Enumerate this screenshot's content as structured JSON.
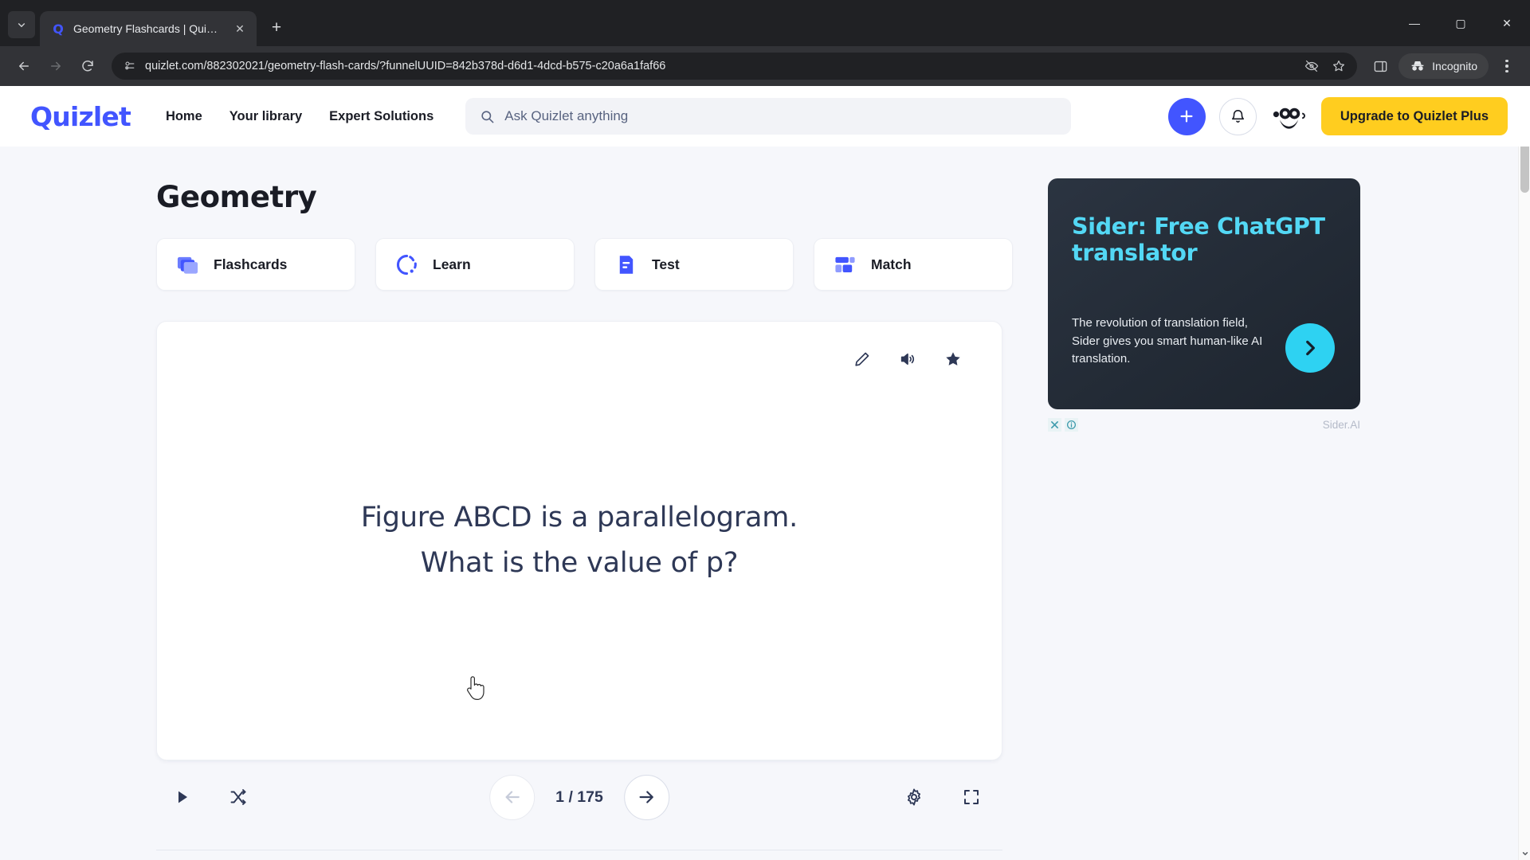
{
  "browser": {
    "tab": {
      "title": "Geometry Flashcards | Quizlet",
      "favicon_icon": "quizlet-q-favicon",
      "close_icon": "close-icon"
    },
    "tab_list_icon": "chevron-down-icon",
    "new_tab_icon": "plus-icon",
    "window_controls": {
      "minimize": "minimize-icon",
      "maximize": "maximize-icon",
      "close": "close-icon"
    },
    "nav": {
      "back_icon": "back-arrow-icon",
      "forward_icon": "forward-arrow-icon",
      "reload_icon": "reload-icon"
    },
    "omnibox": {
      "site_info_icon": "site-settings-icon",
      "url": "quizlet.com/882302021/geometry-flash-cards/?funnelUUID=842b378d-d6d1-4dcd-b575-c20a6a1faf66",
      "tracking_icon": "eye-slash-icon",
      "bookmark_icon": "star-outline-icon"
    },
    "side_panel_icon": "side-panel-icon",
    "incognito": {
      "label": "Incognito",
      "icon": "incognito-icon"
    },
    "menu_icon": "three-dot-menu-icon"
  },
  "quizlet_header": {
    "logo": "Quizlet",
    "nav": [
      {
        "label": "Home",
        "name": "nav-home"
      },
      {
        "label": "Your library",
        "name": "nav-your-library"
      },
      {
        "label": "Expert Solutions",
        "name": "nav-expert-solutions"
      }
    ],
    "search": {
      "placeholder": "Ask Quizlet anything",
      "icon": "search-icon"
    },
    "create_icon": "plus-icon",
    "notifications_icon": "bell-icon",
    "avatar_name": "user-avatar",
    "upgrade_label": "Upgrade to Quizlet Plus",
    "accent_blue": "#4255ff",
    "accent_yellow": "#ffcd1f"
  },
  "study_set": {
    "title": "Geometry",
    "modes": [
      {
        "label": "Flashcards",
        "icon": "flashcards-icon",
        "name": "mode-flashcards"
      },
      {
        "label": "Learn",
        "icon": "learn-icon",
        "name": "mode-learn"
      },
      {
        "label": "Test",
        "icon": "test-icon",
        "name": "mode-test"
      },
      {
        "label": "Match",
        "icon": "match-icon",
        "name": "mode-match"
      }
    ]
  },
  "flashcard": {
    "tools": [
      {
        "icon": "edit-pencil-icon",
        "name": "edit-card-button"
      },
      {
        "icon": "audio-speaker-icon",
        "name": "play-audio-button"
      },
      {
        "icon": "star-filled-icon",
        "name": "star-card-button"
      }
    ],
    "line1": "Figure ABCD is a parallelogram.",
    "line2": "What is the value of p?"
  },
  "card_controls": {
    "play_icon": "play-icon",
    "shuffle_icon": "shuffle-icon",
    "prev_icon": "arrow-left-icon",
    "next_icon": "arrow-right-icon",
    "counter": "1 / 175",
    "settings_icon": "gear-icon",
    "fullscreen_icon": "fullscreen-icon"
  },
  "ad": {
    "headline": "Sider: Free ChatGPT translator",
    "body": "The revolution of translation field, Sider gives you smart human-like AI translation.",
    "cta_icon": "chevron-right-icon",
    "close_icon": "ad-close-icon",
    "info_icon": "ad-info-icon",
    "brand": "Sider.AI",
    "headline_color": "#53d8f5",
    "cta_color": "#2ed2f2"
  },
  "scrollbar": {
    "up_icon": "scroll-up-arrow",
    "down_icon": "scroll-down-arrow"
  }
}
